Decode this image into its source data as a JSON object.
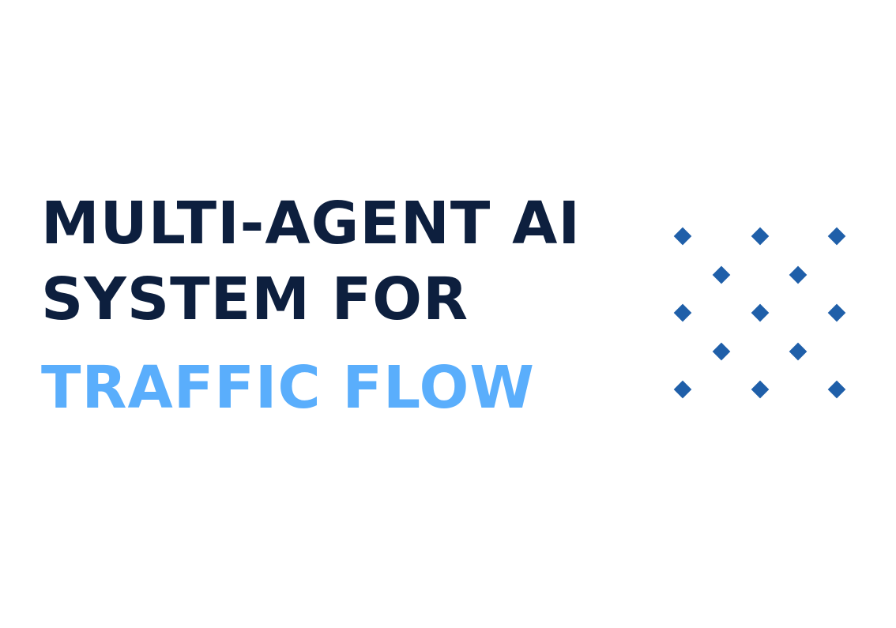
{
  "title": {
    "line1": "MULTI-AGENT AI",
    "line2": "SYSTEM FOR",
    "line3": "TRAFFIC FLOW"
  },
  "colors": {
    "primary_text": "#0d1f3e",
    "accent_text": "#5aaefc",
    "pattern": "#1f5fa9",
    "background": "#ffffff"
  },
  "decor": {
    "icon": "diamond-lattice-icon"
  }
}
